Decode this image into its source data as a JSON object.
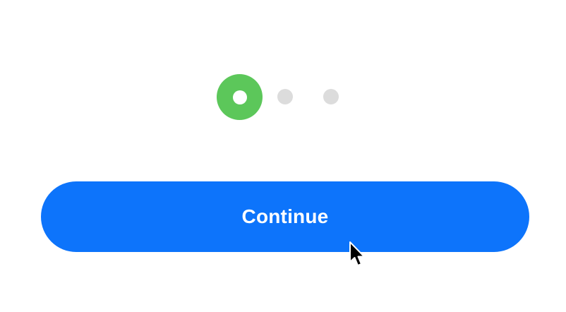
{
  "stepper": {
    "current_step": 1,
    "total_steps": 3,
    "steps": [
      {
        "state": "active"
      },
      {
        "state": "inactive"
      },
      {
        "state": "inactive"
      }
    ]
  },
  "continue_button": {
    "label": "Continue"
  },
  "cursor": {
    "icon": "arrow-pointer-icon"
  },
  "colors": {
    "background": "#ffffff",
    "step_active": "#5cc75a",
    "step_inactive": "#dcdcdc",
    "button": "#0d74fb",
    "button_text": "#ffffff"
  }
}
